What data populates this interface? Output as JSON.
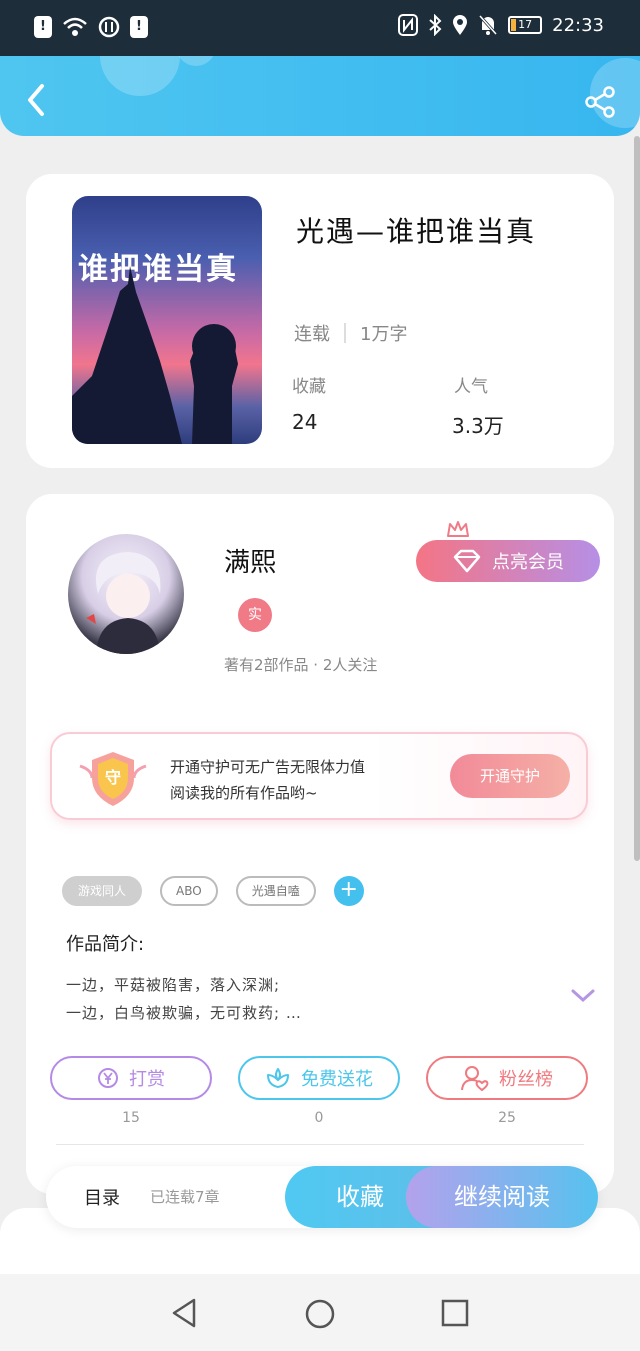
{
  "status_bar": {
    "time": "22:33",
    "battery": "17",
    "icons_left": [
      "alert-icon",
      "wifi-icon",
      "data-speed-icon",
      "sim-icon"
    ],
    "icons_right": [
      "nfc-icon",
      "bluetooth-icon",
      "location-icon",
      "mute-icon",
      "battery-icon"
    ]
  },
  "header": {
    "back_icon": "chevron-left-icon",
    "share_icon": "share-icon"
  },
  "book": {
    "cover_title": "谁把谁当真",
    "title": "光遇—谁把谁当真",
    "status": "连载",
    "word_count": "1万字",
    "favorites_label": "收藏",
    "favorites_value": "24",
    "popularity_label": "人气",
    "popularity_value": "3.3万"
  },
  "author": {
    "name": "满熙",
    "verified_badge": "实",
    "meta": "著有2部作品 · 2人关注",
    "vip_button": "点亮会员"
  },
  "guard": {
    "badge_text": "守",
    "line1": "开通守护可无广告无限体力值",
    "line2": "阅读我的所有作品哟~",
    "button": "开通守护"
  },
  "tags": [
    "游戏同人",
    "ABO",
    "光遇自嗑"
  ],
  "intro": {
    "label": "作品简介:",
    "line1": "一边，平菇被陷害，落入深渊;",
    "line2": "一边，白鸟被欺骗，无可救药; …"
  },
  "actions": [
    {
      "label": "打赏",
      "count": "15",
      "color": "#b58ae6"
    },
    {
      "label": "免费送花",
      "count": "0",
      "color": "#4cc6ea"
    },
    {
      "label": "粉丝榜",
      "count": "25",
      "color": "#ef7a7f"
    }
  ],
  "bottom": {
    "toc": "目录",
    "chapters": "已连载7章",
    "favorite": "收藏",
    "continue": "继续阅读"
  },
  "nav": [
    "back-triangle-icon",
    "home-circle-icon",
    "recents-square-icon"
  ]
}
